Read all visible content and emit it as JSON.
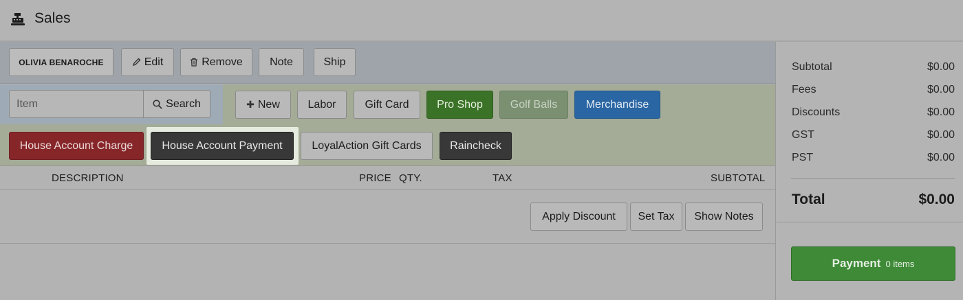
{
  "header": {
    "title": "Sales",
    "icon": "cash-register-icon"
  },
  "toolbar": {
    "customer": "OLIVIA BENAROCHE",
    "edit": "Edit",
    "remove": "Remove",
    "note": "Note",
    "ship": "Ship"
  },
  "search": {
    "placeholder": "Item",
    "button": "Search"
  },
  "categories": {
    "new": "New",
    "labor": "Labor",
    "gift_card": "Gift Card",
    "pro_shop": "Pro Shop",
    "golf_balls": "Golf Balls",
    "merchandise": "Merchandise"
  },
  "quick": {
    "house_charge": "House Account Charge",
    "house_payment": "House Account Payment",
    "loyal_action": "LoyalAction Gift Cards",
    "raincheck": "Raincheck"
  },
  "table": {
    "columns": [
      "DESCRIPTION",
      "PRICE",
      "QTY.",
      "TAX",
      "SUBTOTAL"
    ]
  },
  "actions": {
    "apply_discount": "Apply Discount",
    "set_tax": "Set Tax",
    "show_notes": "Show Notes"
  },
  "summary": {
    "rows": [
      {
        "label": "Subtotal",
        "value": "$0.00"
      },
      {
        "label": "Fees",
        "value": "$0.00"
      },
      {
        "label": "Discounts",
        "value": "$0.00"
      },
      {
        "label": "GST",
        "value": "$0.00"
      },
      {
        "label": "PST",
        "value": "$0.00"
      }
    ],
    "total_label": "Total",
    "total_value": "$0.00"
  },
  "payment": {
    "label": "Payment",
    "count": "0 items"
  },
  "colors": {
    "pro_shop": "#3a7227",
    "golf_balls": "#7a9071",
    "merchandise": "#2a66a3",
    "house_charge": "#872629",
    "house_payment": "#383838",
    "raincheck": "#383838",
    "payment": "#3e8a37"
  }
}
